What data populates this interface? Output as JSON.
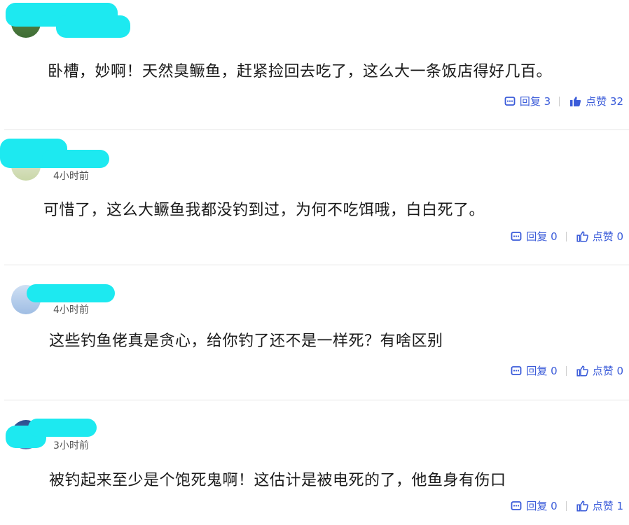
{
  "comments": [
    {
      "username": "",
      "time": "",
      "text": "卧槽，妙啊！天然臭鳜鱼，赶紧捡回去吃了，这么大一条饭店得好几百。",
      "reply_label": "回复 3",
      "like_label": "点赞 32",
      "liked": true
    },
    {
      "username": "",
      "time": "4小时前",
      "text": "可惜了，这么大鳜鱼我都没钓到过，为何不吃饵哦，白白死了。",
      "reply_label": "回复 0",
      "like_label": "点赞 0",
      "liked": false
    },
    {
      "username": "",
      "time": "4小时前",
      "text": "这些钓鱼佬真是贪心，给你钓了还不是一样死？有啥区别",
      "reply_label": "回复 0",
      "like_label": "点赞 0",
      "liked": false
    },
    {
      "username": "",
      "time": "3小时前",
      "text": "被钓起来至少是个饱死鬼啊！这估计是被电死的了，他鱼身有伤口",
      "reply_label": "回复 0",
      "like_label": "点赞 1",
      "liked": false
    }
  ],
  "colors": {
    "accent": "#3a5bd9",
    "redaction": "#1de9f0"
  }
}
